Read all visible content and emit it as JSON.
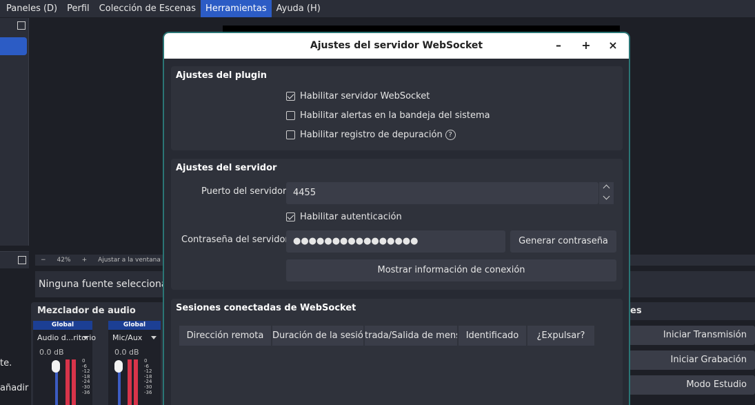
{
  "menu": [
    "Paneles (D)",
    "Perfil",
    "Colección de Escenas",
    "Herramientas",
    "Ayuda (H)"
  ],
  "background": {
    "left_text_1": "te.",
    "left_text_2": "añadir",
    "zoom_minus": "−",
    "zoom_value": "42%",
    "zoom_plus": "+",
    "zoom_fit": "Ajustar a la ventana",
    "source_text": "Ninguna fuente selecciona",
    "mixer_title": "Mezclador de audio",
    "channels": [
      {
        "header": "Global",
        "name": "Audio d...ritorio",
        "db": "0.0 dB"
      },
      {
        "header": "Global",
        "name": "Mic/Aux",
        "db": "0.0 dB"
      }
    ],
    "meter_ticks": [
      "0",
      "-6",
      "-12",
      "-18",
      "-24",
      "-30",
      "-36"
    ],
    "controls_title_fragment": "es",
    "controls": [
      "Iniciar Transmisión",
      "Iniciar Grabación",
      "Modo Estudio"
    ]
  },
  "dialog": {
    "title": "Ajustes del servidor WebSocket",
    "plugin_group": {
      "title": "Ajustes del plugin",
      "enable_server": "Habilitar servidor WebSocket",
      "enable_alerts": "Habilitar alertas en la bandeja del sistema",
      "enable_debug": "Habilitar registro de depuración",
      "help_glyph": "?"
    },
    "server_group": {
      "title": "Ajustes del servidor",
      "port_label": "Puerto del servidor",
      "port_value": "4455",
      "enable_auth": "Habilitar autenticación",
      "password_label": "Contraseña del servidor",
      "password_value": "●●●●●●●●●●●●●●●●",
      "generate_button": "Generar contraseña",
      "show_connection_button": "Mostrar información de conexión"
    },
    "sessions_group": {
      "title": "Sesiones conectadas de WebSocket",
      "columns": [
        "Dirección remota",
        "Duración de la sesión",
        "trada/Salida de mensa",
        "Identificado",
        "¿Expulsar?"
      ]
    },
    "checked": {
      "enable_server": true,
      "enable_alerts": false,
      "enable_debug": false,
      "enable_auth": true
    }
  }
}
